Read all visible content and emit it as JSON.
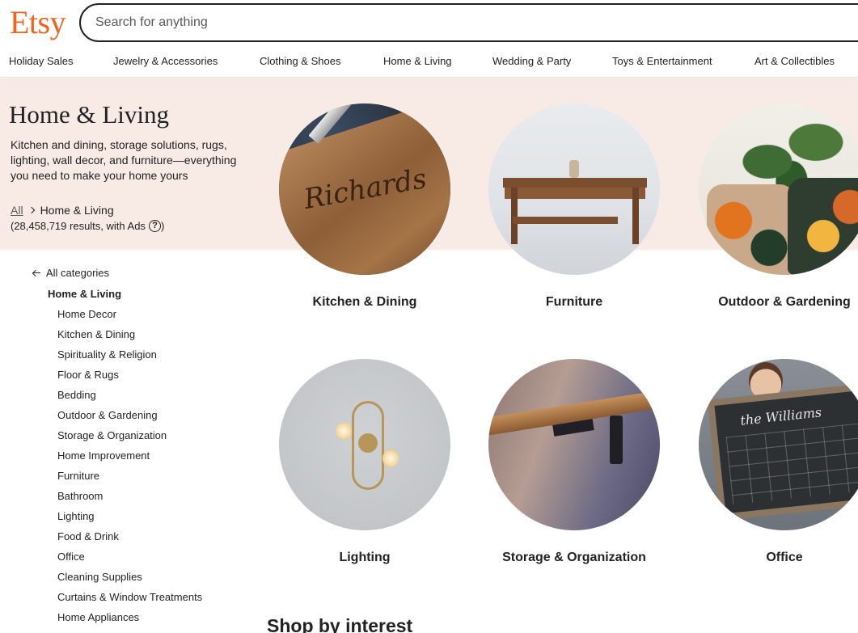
{
  "header": {
    "logo": "Etsy",
    "search_placeholder": "Search for anything"
  },
  "nav": {
    "items": [
      "Holiday Sales",
      "Jewelry & Accessories",
      "Clothing & Shoes",
      "Home & Living",
      "Wedding & Party",
      "Toys & Entertainment",
      "Art & Collectibles"
    ]
  },
  "hero": {
    "title": "Home & Living",
    "description": "Kitchen and dining, storage solutions, rugs, lighting, wall decor, and furniture—everything you need to make your home yours",
    "breadcrumb_root": "All",
    "breadcrumb_current": "Home & Living",
    "results_text": "(28,458,719 results, with Ads",
    "results_close": ")",
    "help_symbol": "?"
  },
  "sidebar": {
    "back_label": "All categories",
    "current": "Home & Living",
    "items": [
      "Home Decor",
      "Kitchen & Dining",
      "Spirituality & Religion",
      "Floor & Rugs",
      "Bedding",
      "Outdoor & Gardening",
      "Storage & Organization",
      "Home Improvement",
      "Furniture",
      "Bathroom",
      "Lighting",
      "Food & Drink",
      "Office",
      "Cleaning Supplies",
      "Curtains & Window Treatments",
      "Home Appliances"
    ]
  },
  "categories": [
    {
      "label": "Kitchen & Dining",
      "board_text": "Richards"
    },
    {
      "label": "Furniture"
    },
    {
      "label": "Outdoor & Gardening"
    },
    {
      "label": "Lighting"
    },
    {
      "label": "Storage & Organization"
    },
    {
      "label": "Office",
      "chalk_text": "the Williams"
    }
  ],
  "section": {
    "title": "Shop by interest"
  },
  "colors": {
    "brand": "#f1641e",
    "hero_bg": "#f8ebe6"
  }
}
